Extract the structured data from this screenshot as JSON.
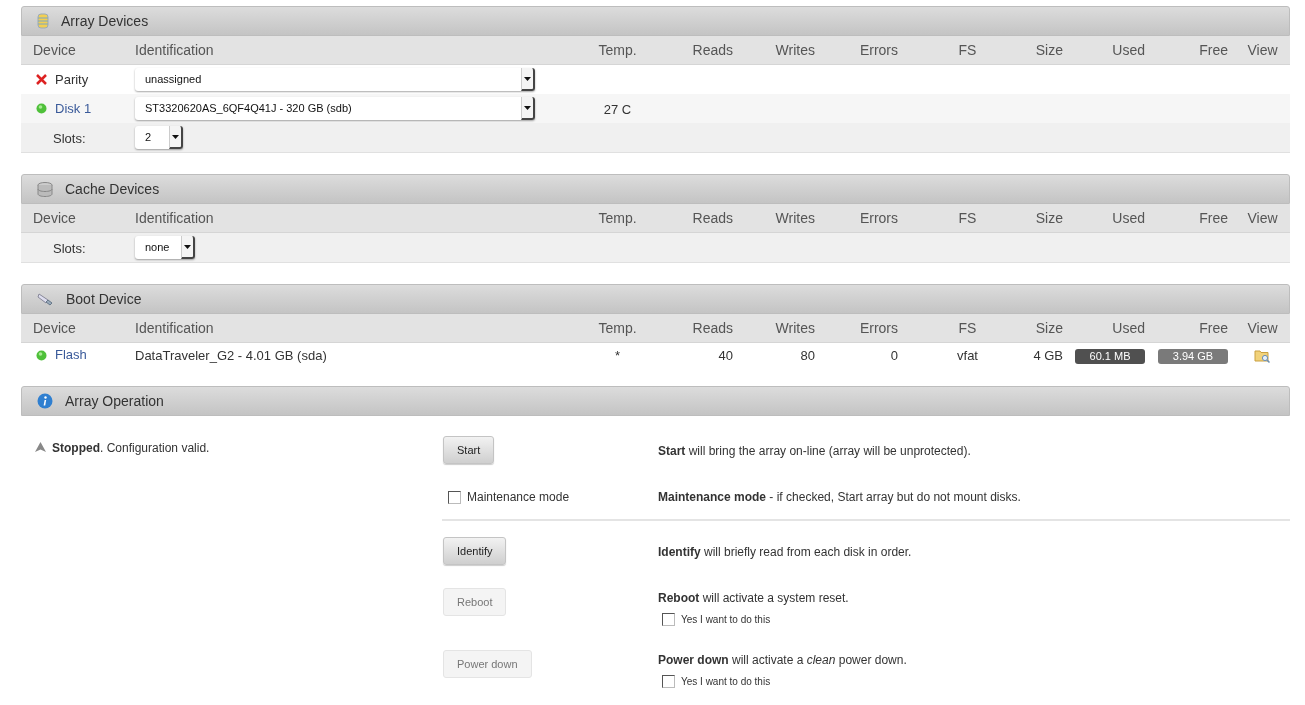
{
  "array_devices": {
    "title": "Array Devices",
    "columns": [
      "Device",
      "Identification",
      "Temp.",
      "Reads",
      "Writes",
      "Errors",
      "FS",
      "Size",
      "Used",
      "Free",
      "View"
    ],
    "rows": [
      {
        "assigned": false,
        "device": "Parity",
        "link": false,
        "kind": "select",
        "identification": "unassigned",
        "temp": ""
      },
      {
        "assigned": true,
        "device": "Disk 1",
        "link": true,
        "kind": "select",
        "identification": "ST3320620AS_6QF4Q41J - 320 GB (sdb)",
        "temp": "27 C"
      }
    ],
    "slots": {
      "label": "Slots:",
      "value": "2"
    }
  },
  "cache_devices": {
    "title": "Cache Devices",
    "columns": [
      "Device",
      "Identification",
      "Temp.",
      "Reads",
      "Writes",
      "Errors",
      "FS",
      "Size",
      "Used",
      "Free",
      "View"
    ],
    "slots": {
      "label": "Slots:",
      "value": "none"
    }
  },
  "boot_device": {
    "title": "Boot Device",
    "columns": [
      "Device",
      "Identification",
      "Temp.",
      "Reads",
      "Writes",
      "Errors",
      "FS",
      "Size",
      "Used",
      "Free",
      "View"
    ],
    "rows": [
      {
        "assigned": true,
        "device": "Flash",
        "link": true,
        "kind": "text",
        "identification": "DataTraveler_G2 - 4.01 GB (sda)",
        "temp": "*",
        "reads": "40",
        "writes": "80",
        "errors": "0",
        "fs": "vfat",
        "size": "4 GB",
        "used": "60.1 MB",
        "free": "3.94 GB",
        "view": true
      }
    ]
  },
  "array_operation": {
    "title": "Array Operation",
    "status": {
      "started": false,
      "text": "**Stopped**. Configuration valid."
    },
    "operations": [
      {
        "kind": "button",
        "label": "Start",
        "disabled": false,
        "description": "**Start** will bring the array on-line (array will be unprotected)."
      },
      {
        "kind": "checkbox",
        "label": "Maintenance mode",
        "checked": false,
        "description": "**Maintenance mode** - if checked, Start array but do not mount disks.",
        "divider_after": true
      },
      {
        "kind": "button",
        "label": "Identify",
        "disabled": false,
        "description": "**Identify** will briefly read from each disk in order."
      },
      {
        "kind": "button",
        "label": "Reboot",
        "disabled": true,
        "description": "**Reboot** will activate a system reset.",
        "confirm": {
          "label": "Yes I want to do this",
          "checked": false
        }
      },
      {
        "kind": "button",
        "label": "Power down",
        "disabled": true,
        "description": "**Power down** will activate a *clean* power down.",
        "confirm": {
          "label": "Yes I want to do this",
          "checked": false
        }
      }
    ]
  }
}
